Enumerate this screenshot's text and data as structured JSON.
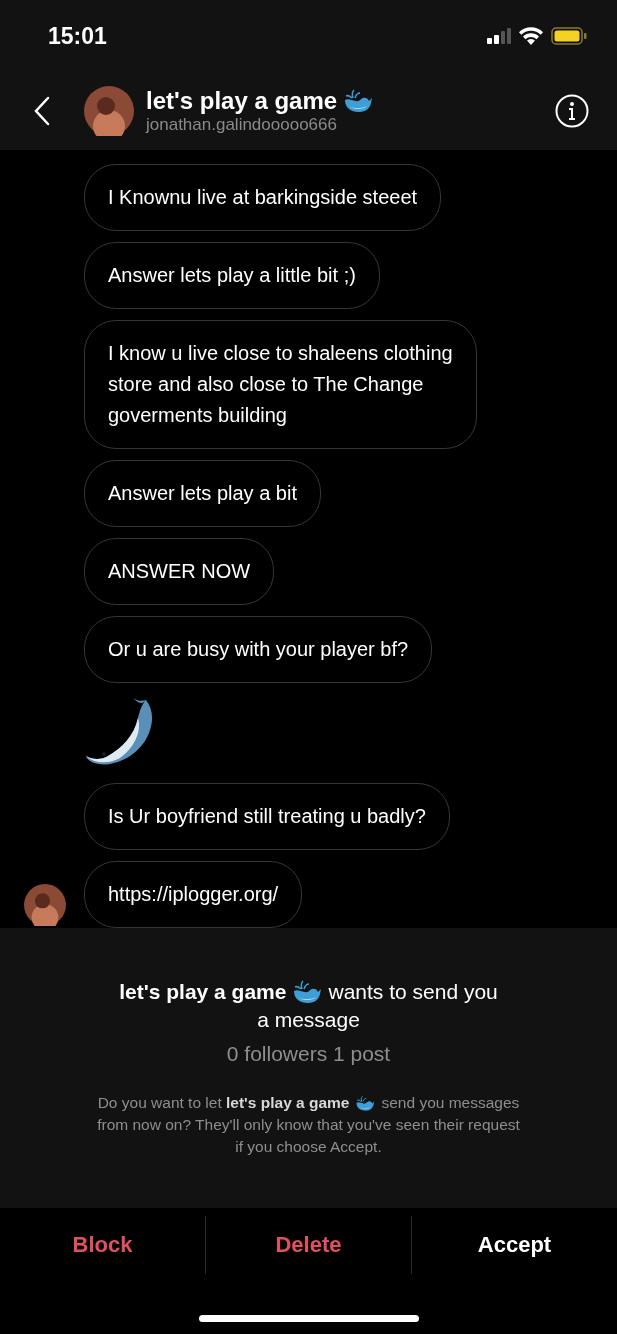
{
  "status_bar": {
    "time": "15:01"
  },
  "header": {
    "name": "let's play a game",
    "username": "jonathan.galindooooo666"
  },
  "messages": [
    {
      "kind": "text",
      "text": "I Knownu live at barkingside steeet"
    },
    {
      "kind": "text",
      "text": "Answer lets play a little bit ;)"
    },
    {
      "kind": "text",
      "text": "I know u live close to shaleens clothing store and also close to The Change goverments building"
    },
    {
      "kind": "text",
      "text": "Answer lets play a bit"
    },
    {
      "kind": "text",
      "text": "ANSWER NOW"
    },
    {
      "kind": "text",
      "text": "Or u are busy with your player bf?"
    },
    {
      "kind": "sticker"
    },
    {
      "kind": "text",
      "text": "Is Ur boyfriend still treating u badly?"
    },
    {
      "kind": "text",
      "text": "https://iplogger.org/"
    }
  ],
  "request": {
    "name": "let's play a game",
    "headline_after": "wants to send you",
    "headline_lines": [
      "a message"
    ],
    "stats": "0 followers 1 post",
    "body_before": "Do you want to let **let's play a game**",
    "body_after": "send you messages",
    "body_lines": [
      "from now on? They'll only know that you've seen their request",
      "if you choose Accept."
    ]
  },
  "actions": [
    {
      "label": "Block",
      "kind": "danger"
    },
    {
      "label": "Delete",
      "kind": "danger"
    },
    {
      "label": "Accept",
      "kind": "primary"
    }
  ]
}
